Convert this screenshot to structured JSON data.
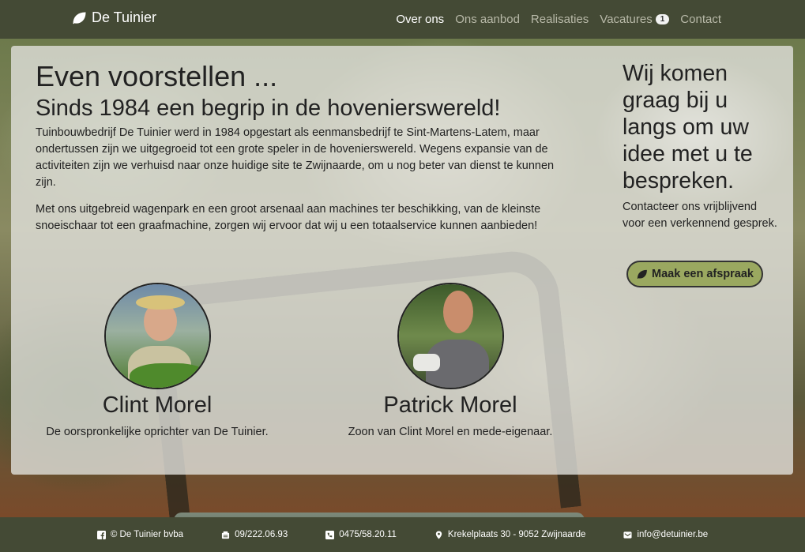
{
  "brand": {
    "name": "De Tuinier",
    "icon": "leaf-icon"
  },
  "nav": {
    "items": [
      {
        "label": "Over ons",
        "active": true
      },
      {
        "label": "Ons aanbod"
      },
      {
        "label": "Realisaties"
      },
      {
        "label": "Vacatures",
        "badge": "1"
      },
      {
        "label": "Contact"
      }
    ]
  },
  "main": {
    "title": "Even voorstellen ...",
    "subtitle": "Sinds 1984 een begrip in de hovenierswereld!",
    "paragraphs": [
      "Tuinbouwbedrijf De Tuinier werd in 1984 opgestart als eenmansbedrijf te Sint-Martens-Latem, maar ondertussen zijn we uitgegroeid tot een grote speler in de hovenierswereld. Wegens expansie van de activiteiten zijn we verhuisd naar onze huidige site te Zwijnaarde, om u nog beter van dienst te kunnen zijn.",
      "Met ons uitgebreid wagenpark en een groot arsenaal aan machines ter beschikking, van de kleinste snoeischaar tot een graafmachine, zorgen wij ervoor dat wij u een totaalservice kunnen aanbieden!"
    ],
    "people": [
      {
        "name": "Clint Morel",
        "role": "De oorspronkelijke oprichter van De Tuinier."
      },
      {
        "name": "Patrick Morel",
        "role": "Zoon van Clint Morel en mede-eigenaar."
      }
    ]
  },
  "sidebar": {
    "heading": "Wij komen graag bij u langs om uw idee met u te bespreken.",
    "text": "Contacteer ons vrijblijvend voor een verkennend gesprek.",
    "button": "Maak een afspraak"
  },
  "footer": {
    "company": "© De Tuinier bvba",
    "phone": "09/222.06.93",
    "mobile": "0475/58.20.11",
    "address": "Krekelplaats 30 - 9052 Zwijnaarde",
    "email": "info@detuinier.be"
  },
  "colors": {
    "bar": "#444a35",
    "button": "#9aa860"
  }
}
